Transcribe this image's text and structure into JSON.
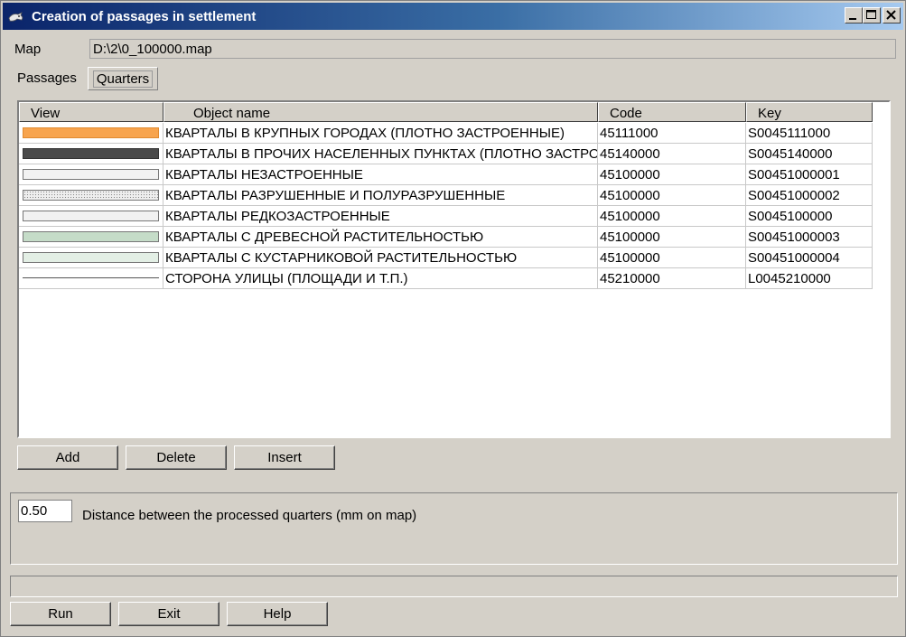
{
  "window": {
    "title": "Creation of passages in settlement",
    "icon": "dolphin-icon"
  },
  "map": {
    "label": "Map",
    "value": "D:\\2\\0_100000.map"
  },
  "tabs": [
    {
      "label": "Passages",
      "selected": false
    },
    {
      "label": "Quarters",
      "selected": true
    }
  ],
  "table": {
    "columns": [
      "View",
      "Object name",
      "Code",
      "Key"
    ],
    "rows": [
      {
        "view": "orange-fill",
        "name": "КВАРТАЛЫ В КРУПНЫХ ГОРОДАХ (ПЛОТНО ЗАСТРОЕННЫЕ)",
        "code": "45111000",
        "key": "S0045111000"
      },
      {
        "view": "dark-gray-fill",
        "name": "КВАРТАЛЫ В ПРОЧИХ НАСЕЛЕННЫХ ПУНКТАХ (ПЛОТНО ЗАСТРОЕННЫЕ)",
        "code": "45140000",
        "key": "S0045140000"
      },
      {
        "view": "light-fill",
        "name": "КВАРТАЛЫ НЕЗАСТРОЕННЫЕ",
        "code": "45100000",
        "key": "S00451000001"
      },
      {
        "view": "dotted-fill",
        "name": "КВАРТАЛЫ РАЗРУШЕННЫЕ И ПОЛУРАЗРУШЕННЫЕ",
        "code": "45100000",
        "key": "S00451000002"
      },
      {
        "view": "light-fill",
        "name": "КВАРТАЛЫ РЕДКОЗАСТРОЕННЫЕ",
        "code": "45100000",
        "key": "S0045100000"
      },
      {
        "view": "green-fill",
        "name": "КВАРТАЛЫ С ДРЕВЕСНОЙ РАСТИТЕЛЬНОСТЬЮ",
        "code": "45100000",
        "key": "S00451000003"
      },
      {
        "view": "pale-green-fill",
        "name": "КВАРТАЛЫ С КУСТАРНИКОВОЙ РАСТИТЕЛЬНОСТЬЮ",
        "code": "45100000",
        "key": "S00451000004"
      },
      {
        "view": "line",
        "name": "СТОРОНА УЛИЦЫ (ПЛОЩАДИ И Т.П.)",
        "code": "45210000",
        "key": "L0045210000"
      }
    ]
  },
  "table_buttons": {
    "add": "Add",
    "delete": "Delete",
    "insert": "Insert"
  },
  "distance": {
    "value": "0.50",
    "label": "Distance between the processed quarters (mm on map)"
  },
  "status": "",
  "footer_buttons": {
    "run": "Run",
    "exit": "Exit",
    "help": "Help"
  },
  "colors": {
    "titlebar_start": "#0a246a",
    "titlebar_end": "#a6caf0",
    "face": "#d4d0c8",
    "orange": "#f7a44e",
    "dark_gray": "#4a4a4a",
    "green": "#c5dcc8",
    "pale_green": "#e3efe5"
  }
}
